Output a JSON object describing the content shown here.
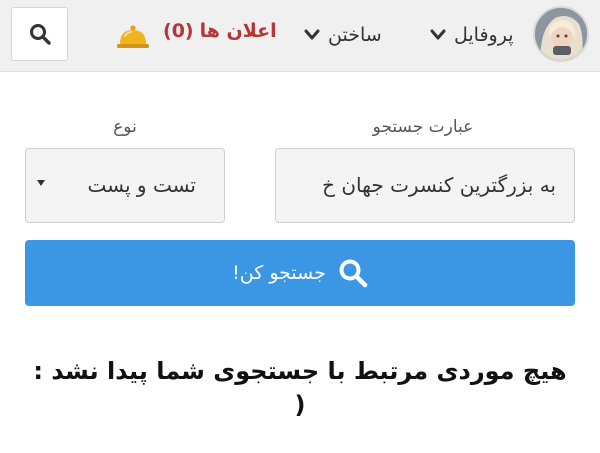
{
  "header": {
    "notifications_label": "اعلان ها",
    "notifications_count": "(0)",
    "build_label": "ساختن",
    "profile_label": "پروفایل"
  },
  "form": {
    "phrase_label": "عبارت جستجو",
    "phrase_value": "به بزرگترین کنسرت جهان خ",
    "type_label": "نوع",
    "type_selected": "تست و پست",
    "submit_label": "جستجو کن!"
  },
  "result": {
    "message": "هیچ موردی مرتبط با جستجوی شما پیدا نشد :(",
    "message_line1": "هیچ موردی مرتبط با جستجوی شما پیدا نشد :",
    "message_line2": "("
  },
  "colors": {
    "accent": "#3b97e3",
    "notification": "#b63535",
    "bell": "#f2b321"
  },
  "icons": [
    "search-icon",
    "bell-icon",
    "chevron-down-icon",
    "caret-down-icon",
    "avatar"
  ]
}
